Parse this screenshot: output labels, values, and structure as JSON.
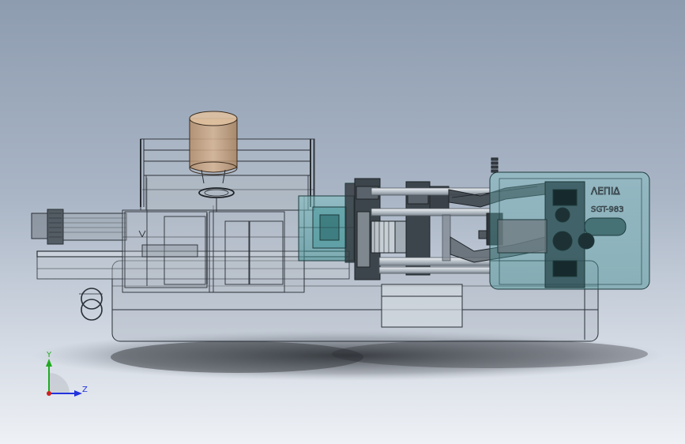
{
  "axis_triad": {
    "y_label": "Y",
    "z_label": "Z",
    "y_color": "#22aa22",
    "z_color": "#2233dd",
    "x_color": "#cc2222"
  },
  "nameplate": {
    "line1": "ΛΕΠΙΔ",
    "line2": "SGT-983"
  },
  "colors": {
    "background_top": "#8e9cb0",
    "background_bottom": "#eef1f5",
    "clamp_glass": "#5aa8aa",
    "hopper": "#c9a27e",
    "wire": "#2a2f35"
  }
}
